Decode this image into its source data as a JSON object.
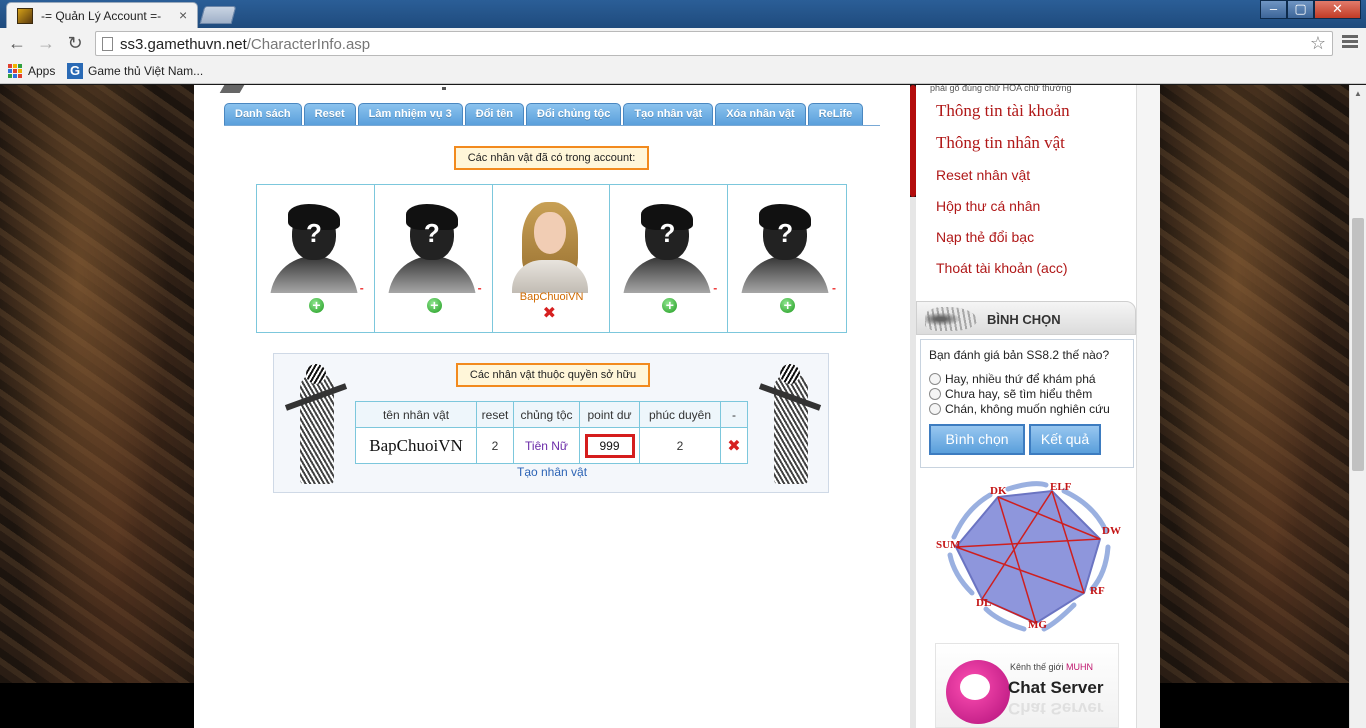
{
  "browser": {
    "tab_title": "-= Quản Lý Account =-",
    "tab_close": "×",
    "url_host": "ss3.gamethuvn.net",
    "url_path": "/CharacterInfo.asp",
    "star": "☆",
    "bookmarks": [
      {
        "label": "Apps",
        "icon": "apps-grid-icon"
      },
      {
        "label": "Game thủ Việt Nam...",
        "icon": "g-icon"
      }
    ],
    "window": {
      "minimize": "–",
      "maximize": "▢",
      "close": "✕"
    }
  },
  "tabs": [
    "Danh sách",
    "Reset",
    "Làm nhiệm vụ 3",
    "Đổi tên",
    "Đổi chủng tộc",
    "Tạo nhân vật",
    "Xóa nhân vật",
    "ReLife"
  ],
  "existing": {
    "label": "Các nhân vật đã có trong account:",
    "slots": [
      {
        "type": "empty",
        "mark": "?",
        "dash": "-"
      },
      {
        "type": "empty",
        "mark": "?",
        "dash": "-"
      },
      {
        "type": "character",
        "name": "BapChuoiVN",
        "delete": "✖"
      },
      {
        "type": "empty",
        "mark": "?",
        "dash": "-"
      },
      {
        "type": "empty",
        "mark": "?",
        "dash": "-"
      }
    ],
    "add_symbol": "+"
  },
  "owned": {
    "label": "Các nhân vật thuộc quyền sở hữu",
    "columns": [
      "tên nhân vật",
      "reset",
      "chủng tộc",
      "point dư",
      "phúc duyên",
      "-"
    ],
    "rows": [
      {
        "name": "BapChuoiVN",
        "reset": "2",
        "race": "Tiên Nữ",
        "points": "999",
        "fortune": "2",
        "delete": "✖"
      }
    ],
    "create_link": "Tạo nhân vật"
  },
  "sidebar": {
    "hint": "phải gõ đúng chữ HOA chữ thường",
    "links_big": [
      "Thông tin tài khoản",
      "Thông tin nhân vật"
    ],
    "links_small": [
      "Reset nhân vật",
      "Hộp thư cá nhân",
      "Nạp thẻ đổi bạc",
      "Thoát tài khoản (acc)"
    ]
  },
  "poll": {
    "title": "BÌNH CHỌN",
    "question": "Bạn đánh giá bản SS8.2 thế nào?",
    "options": [
      "Hay, nhiều thứ để khám phá",
      "Chưa hay, sẽ tìm hiểu thêm",
      "Chán, không muốn nghiên cứu"
    ],
    "vote_button": "Bình chọn",
    "result_button": "Kết quả"
  },
  "classes": [
    "DK",
    "ELF",
    "DW",
    "RF",
    "MG",
    "DL",
    "SUM"
  ],
  "chat_banner": {
    "prefix": "Kênh thế giới ",
    "accent": "MUHN",
    "name": "Chat Server"
  },
  "colors": {
    "accent_red": "#b01818",
    "tab_blue": "#5a9fdb",
    "label_orange": "#f28a1e",
    "table_border": "#7cc7dc"
  }
}
